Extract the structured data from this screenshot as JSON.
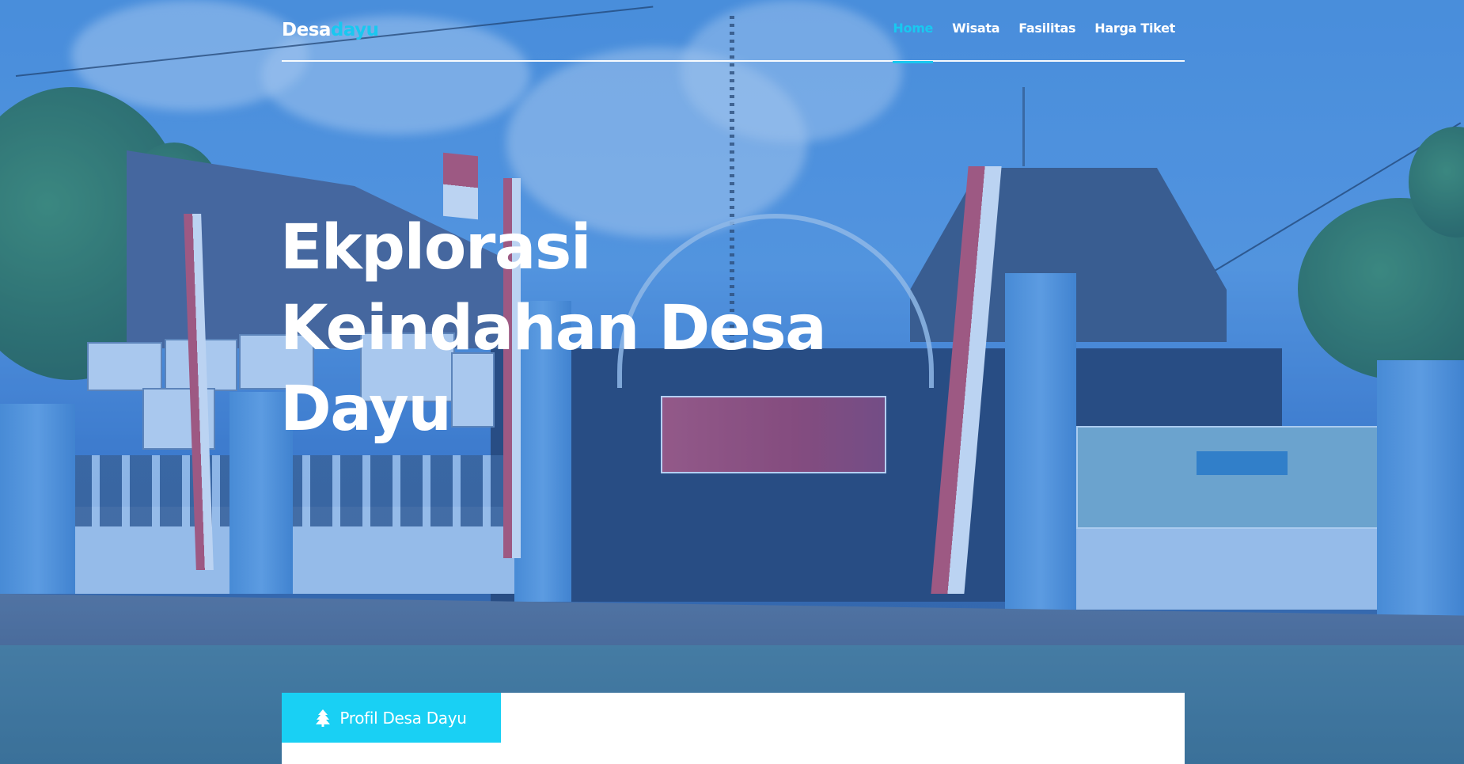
{
  "header": {
    "logo_main": "Desa",
    "logo_accent": "dayu",
    "nav": [
      {
        "label": "Home",
        "active": true
      },
      {
        "label": "Wisata",
        "active": false
      },
      {
        "label": "Fasilitas",
        "active": false
      },
      {
        "label": "Harga Tiket",
        "active": false
      }
    ]
  },
  "hero": {
    "title_lines": [
      "Ekplorasi",
      "Keindahan Desa",
      "Dayu"
    ]
  },
  "card": {
    "tab_label": "Profil Desa Dayu",
    "tab_icon": "tree-icon"
  },
  "colors": {
    "accent": "#19c8f0",
    "tab_bg": "#19d0f4",
    "text": "#ffffff"
  }
}
